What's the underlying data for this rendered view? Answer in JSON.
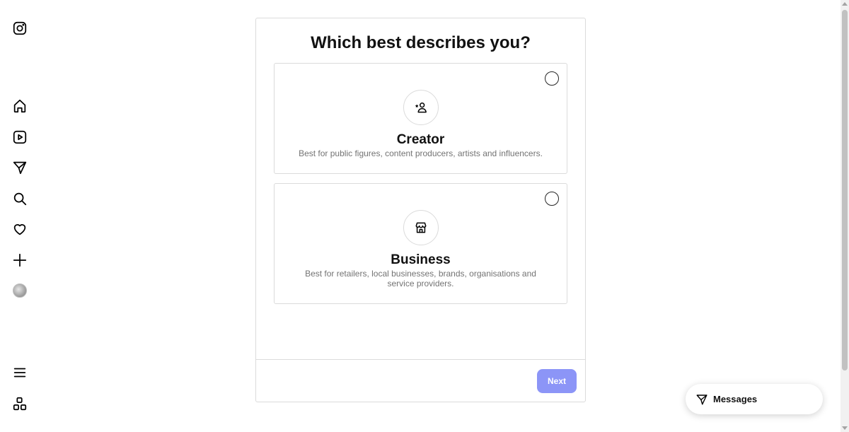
{
  "title": "Which best describes you?",
  "options": [
    {
      "icon": "person-star-icon",
      "title": "Creator",
      "description": "Best for public figures, content producers, artists and influencers.",
      "selected": false
    },
    {
      "icon": "storefront-icon",
      "title": "Business",
      "description": "Best for retailers, local businesses, brands, organisations and service providers.",
      "selected": false
    }
  ],
  "next_label": "Next",
  "messages_label": "Messages",
  "sidebar": {
    "items": [
      {
        "icon": "instagram-icon"
      },
      {
        "icon": "home-icon"
      },
      {
        "icon": "reels-icon"
      },
      {
        "icon": "direct-icon"
      },
      {
        "icon": "search-icon"
      },
      {
        "icon": "heart-icon"
      },
      {
        "icon": "plus-icon"
      },
      {
        "icon": "avatar"
      },
      {
        "icon": "menu-icon"
      },
      {
        "icon": "grid-icon"
      }
    ]
  },
  "colors": {
    "accent": "#8c95f7",
    "border": "#dbdbdb",
    "secondary_text": "#737373"
  }
}
